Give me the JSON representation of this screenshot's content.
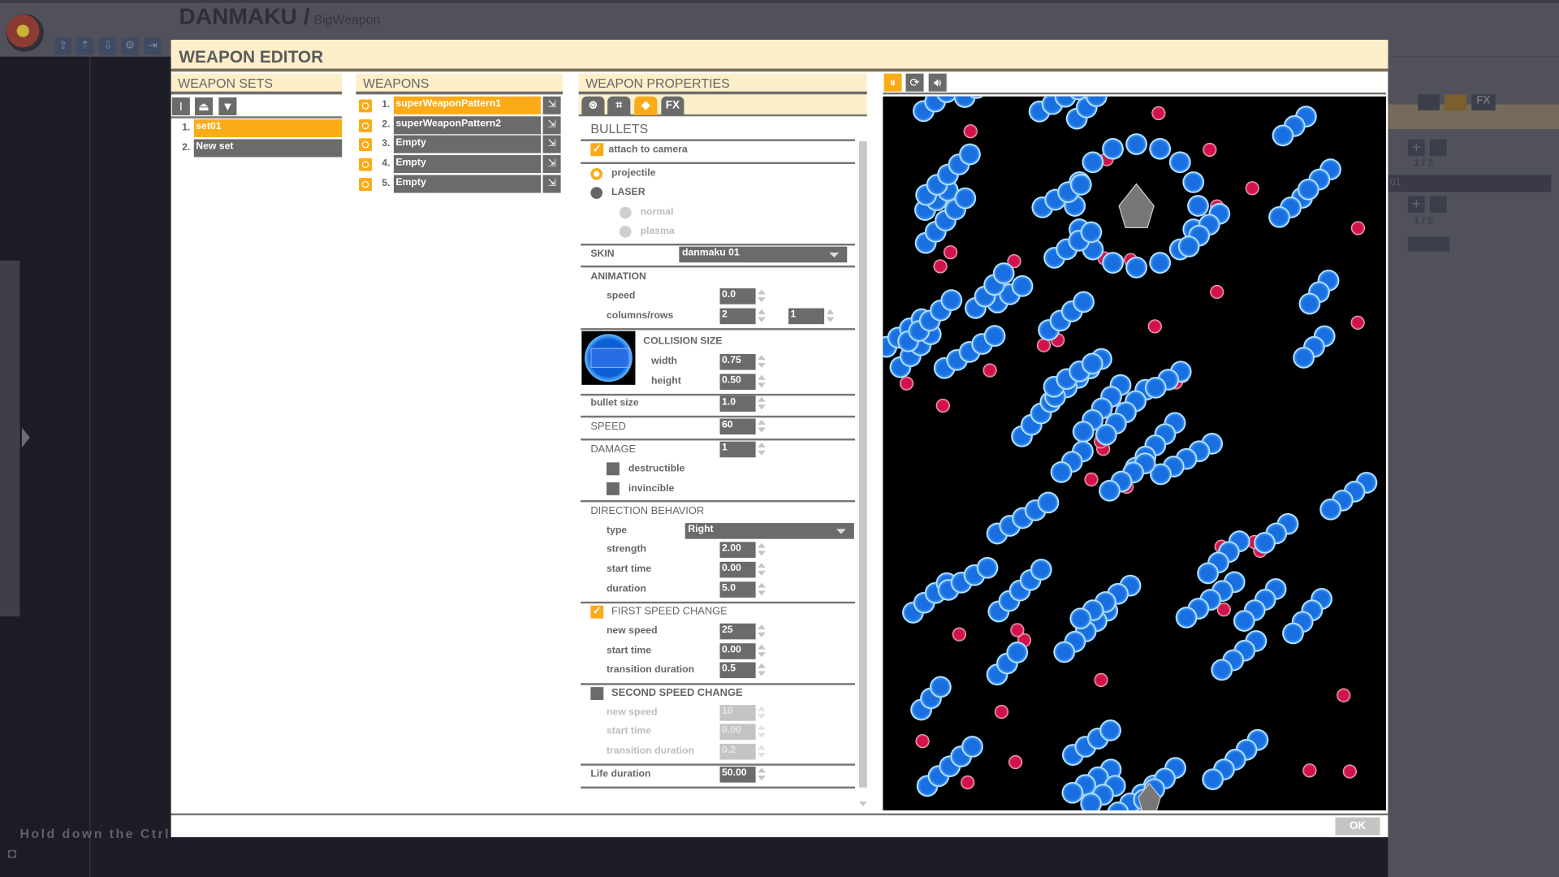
{
  "app": {
    "title": "DANMAKU /",
    "project": "BigWeapon",
    "hint": "Hold down the Ctrl"
  },
  "dialog": {
    "title": "WEAPON EDITOR",
    "ok_label": "OK",
    "weapon_sets": {
      "header": "WEAPON SETS",
      "items": [
        {
          "num": "1.",
          "label": "set01",
          "selected": true
        },
        {
          "num": "2.",
          "label": "New set",
          "selected": false
        }
      ]
    },
    "weapons": {
      "header": "WEAPONS",
      "items": [
        {
          "num": "1.",
          "label": "superWeaponPattern1",
          "selected": true
        },
        {
          "num": "2.",
          "label": "superWeaponPattern2",
          "selected": false
        },
        {
          "num": "3.",
          "label": "Empty",
          "selected": false
        },
        {
          "num": "4.",
          "label": "Empty",
          "selected": false
        },
        {
          "num": "5.",
          "label": "Empty",
          "selected": false
        }
      ]
    },
    "properties": {
      "header": "WEAPON PROPERTIES",
      "tabs": [
        "globe-icon",
        "pattern-icon",
        "bullet-icon",
        "FX"
      ],
      "active_tab": 2,
      "bullets_title": "BULLETS",
      "attach_to_camera": {
        "label": "attach to camera",
        "checked": true
      },
      "type_projectile": "projectile",
      "type_laser": "LASER",
      "laser_normal": "normal",
      "laser_plasma": "plasma",
      "selected_type": "projectile",
      "skin": {
        "label": "SKIN",
        "value": "danmaku 01"
      },
      "animation": {
        "title": "ANIMATION",
        "speed_label": "speed",
        "speed": "0.0",
        "colrows_label": "columns/rows",
        "columns": "2",
        "rows": "1"
      },
      "collision": {
        "title": "COLLISION SIZE",
        "width_label": "width",
        "width": "0.75",
        "height_label": "height",
        "height": "0.50"
      },
      "bullet_size": {
        "label": "bullet size",
        "value": "1.0"
      },
      "speed": {
        "label": "SPEED",
        "value": "60"
      },
      "damage": {
        "label": "DAMAGE",
        "value": "1",
        "destructible": "destructible",
        "invincible": "invincible"
      },
      "direction": {
        "title": "DIRECTION BEHAVIOR",
        "type_label": "type",
        "type": "Right",
        "strength_label": "strength",
        "strength": "2.00",
        "start_label": "start time",
        "start": "0.00",
        "duration_label": "duration",
        "duration": "5.0"
      },
      "first_speed": {
        "title": "FIRST SPEED CHANGE",
        "enabled": true,
        "new_speed_label": "new speed",
        "new_speed": "25",
        "start_label": "start time",
        "start": "0.00",
        "trans_label": "transition duration",
        "trans": "0.5"
      },
      "second_speed": {
        "title": "SECOND SPEED CHANGE",
        "enabled": false,
        "new_speed_label": "new speed",
        "new_speed": "10",
        "start_label": "start time",
        "start": "0.00",
        "trans_label": "transition duration",
        "trans": "0.2"
      },
      "life": {
        "label": "Life duration",
        "value": "50.00"
      }
    },
    "preview": {
      "buttons": [
        "pause-icon",
        "refresh-icon",
        "sound-icon"
      ]
    }
  },
  "right_panel": {
    "page1": "1 / 2",
    "page2": "1 / 5",
    "item": "01",
    "fx": "FX"
  },
  "colors": {
    "accent": "#fbab18",
    "header_bg": "#fdefca",
    "control": "#6b6b6b",
    "bullet_blue": "#1a6fe0",
    "bullet_red": "#d0134a"
  }
}
